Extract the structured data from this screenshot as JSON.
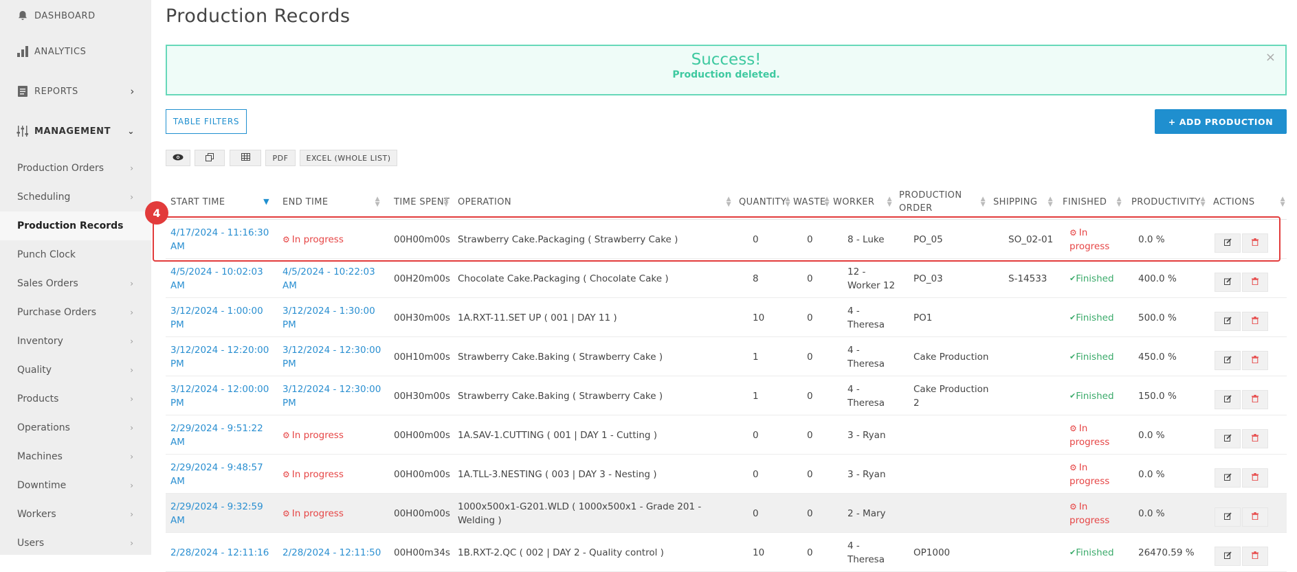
{
  "sidebar": {
    "top": [
      {
        "label": "DASHBOARD",
        "icon": "bell-icon"
      },
      {
        "label": "ANALYTICS",
        "icon": "bar-chart-icon"
      },
      {
        "label": "REPORTS",
        "icon": "document-icon"
      },
      {
        "label": "MANAGEMENT",
        "icon": "sliders-icon"
      }
    ],
    "items": [
      {
        "label": "Production Orders"
      },
      {
        "label": "Scheduling"
      },
      {
        "label": "Production Records"
      },
      {
        "label": "Punch Clock"
      },
      {
        "label": "Sales Orders"
      },
      {
        "label": "Purchase Orders"
      },
      {
        "label": "Inventory"
      },
      {
        "label": "Quality"
      },
      {
        "label": "Products"
      },
      {
        "label": "Operations"
      },
      {
        "label": "Machines"
      },
      {
        "label": "Downtime"
      },
      {
        "label": "Workers"
      },
      {
        "label": "Users"
      }
    ]
  },
  "page": {
    "title": "Production Records"
  },
  "alert": {
    "title": "Success!",
    "message": "Production deleted.",
    "close": "×"
  },
  "buttons": {
    "filters": "TABLE FILTERS",
    "add": "+ ADD PRODUCTION"
  },
  "toolbar": {
    "pdf": "PDF",
    "excel": "EXCEL (WHOLE LIST)"
  },
  "table": {
    "headers": [
      "START TIME",
      "END TIME",
      "TIME SPENT",
      "OPERATION",
      "QUANTITY",
      "WASTE",
      "WORKER",
      "PRODUCTION ORDER",
      "SHIPPING",
      "FINISHED",
      "PRODUCTIVITY",
      "ACTIONS"
    ],
    "rows": [
      {
        "start": "4/17/2024 - 11:16:30 AM",
        "end": "In progress",
        "time": "00H00m00s",
        "operation": "Strawberry Cake.Packaging ( Strawberry Cake )",
        "qty": "0",
        "waste": "0",
        "worker": "8 - Luke",
        "order": "PO_05",
        "shipping": "SO_02-01",
        "finished": "In progress",
        "productivity": "0.0 %"
      },
      {
        "start": "4/5/2024 - 10:02:03 AM",
        "end": "4/5/2024 - 10:22:03 AM",
        "time": "00H20m00s",
        "operation": "Chocolate Cake.Packaging ( Chocolate Cake )",
        "qty": "8",
        "waste": "0",
        "worker": "12 - Worker 12",
        "order": "PO_03",
        "shipping": "S-14533",
        "finished": "Finished",
        "productivity": "400.0 %"
      },
      {
        "start": "3/12/2024 - 1:00:00 PM",
        "end": "3/12/2024 - 1:30:00 PM",
        "time": "00H30m00s",
        "operation": "1A.RXT-11.SET UP ( 001 | DAY 11 )",
        "qty": "10",
        "waste": "0",
        "worker": "4 - Theresa",
        "order": "PO1",
        "shipping": "",
        "finished": "Finished",
        "productivity": "500.0 %"
      },
      {
        "start": "3/12/2024 - 12:20:00 PM",
        "end": "3/12/2024 - 12:30:00 PM",
        "time": "00H10m00s",
        "operation": "Strawberry Cake.Baking ( Strawberry Cake )",
        "qty": "1",
        "waste": "0",
        "worker": "4 - Theresa",
        "order": "Cake Production",
        "shipping": "",
        "finished": "Finished",
        "productivity": "450.0 %"
      },
      {
        "start": "3/12/2024 - 12:00:00 PM",
        "end": "3/12/2024 - 12:30:00 PM",
        "time": "00H30m00s",
        "operation": "Strawberry Cake.Baking ( Strawberry Cake )",
        "qty": "1",
        "waste": "0",
        "worker": "4 - Theresa",
        "order": "Cake Production 2",
        "shipping": "",
        "finished": "Finished",
        "productivity": "150.0 %"
      },
      {
        "start": "2/29/2024 - 9:51:22 AM",
        "end": "In progress",
        "time": "00H00m00s",
        "operation": "1A.SAV-1.CUTTING ( 001 | DAY 1 - Cutting )",
        "qty": "0",
        "waste": "0",
        "worker": "3 - Ryan",
        "order": "",
        "shipping": "",
        "finished": "In progress",
        "productivity": "0.0 %"
      },
      {
        "start": "2/29/2024 - 9:48:57 AM",
        "end": "In progress",
        "time": "00H00m00s",
        "operation": "1A.TLL-3.NESTING ( 003 | DAY 3 - Nesting )",
        "qty": "0",
        "waste": "0",
        "worker": "3 - Ryan",
        "order": "",
        "shipping": "",
        "finished": "In progress",
        "productivity": "0.0 %"
      },
      {
        "start": "2/29/2024 - 9:32:59 AM",
        "end": "In progress",
        "time": "00H00m00s",
        "operation": "1000x500x1-G201.WLD ( 1000x500x1 - Grade 201 - Welding )",
        "qty": "0",
        "waste": "0",
        "worker": "2 - Mary",
        "order": "",
        "shipping": "",
        "finished": "In progress",
        "productivity": "0.0 %"
      },
      {
        "start": "2/28/2024 - 12:11:16",
        "end": "2/28/2024 - 12:11:50",
        "time": "00H00m34s",
        "operation": "1B.RXT-2.QC ( 002 | DAY 2 - Quality control )",
        "qty": "10",
        "waste": "0",
        "worker": "4 - Theresa",
        "order": "OP1000",
        "shipping": "",
        "finished": "Finished",
        "productivity": "26470.59 %"
      }
    ]
  },
  "annotation": {
    "badge": "4"
  }
}
